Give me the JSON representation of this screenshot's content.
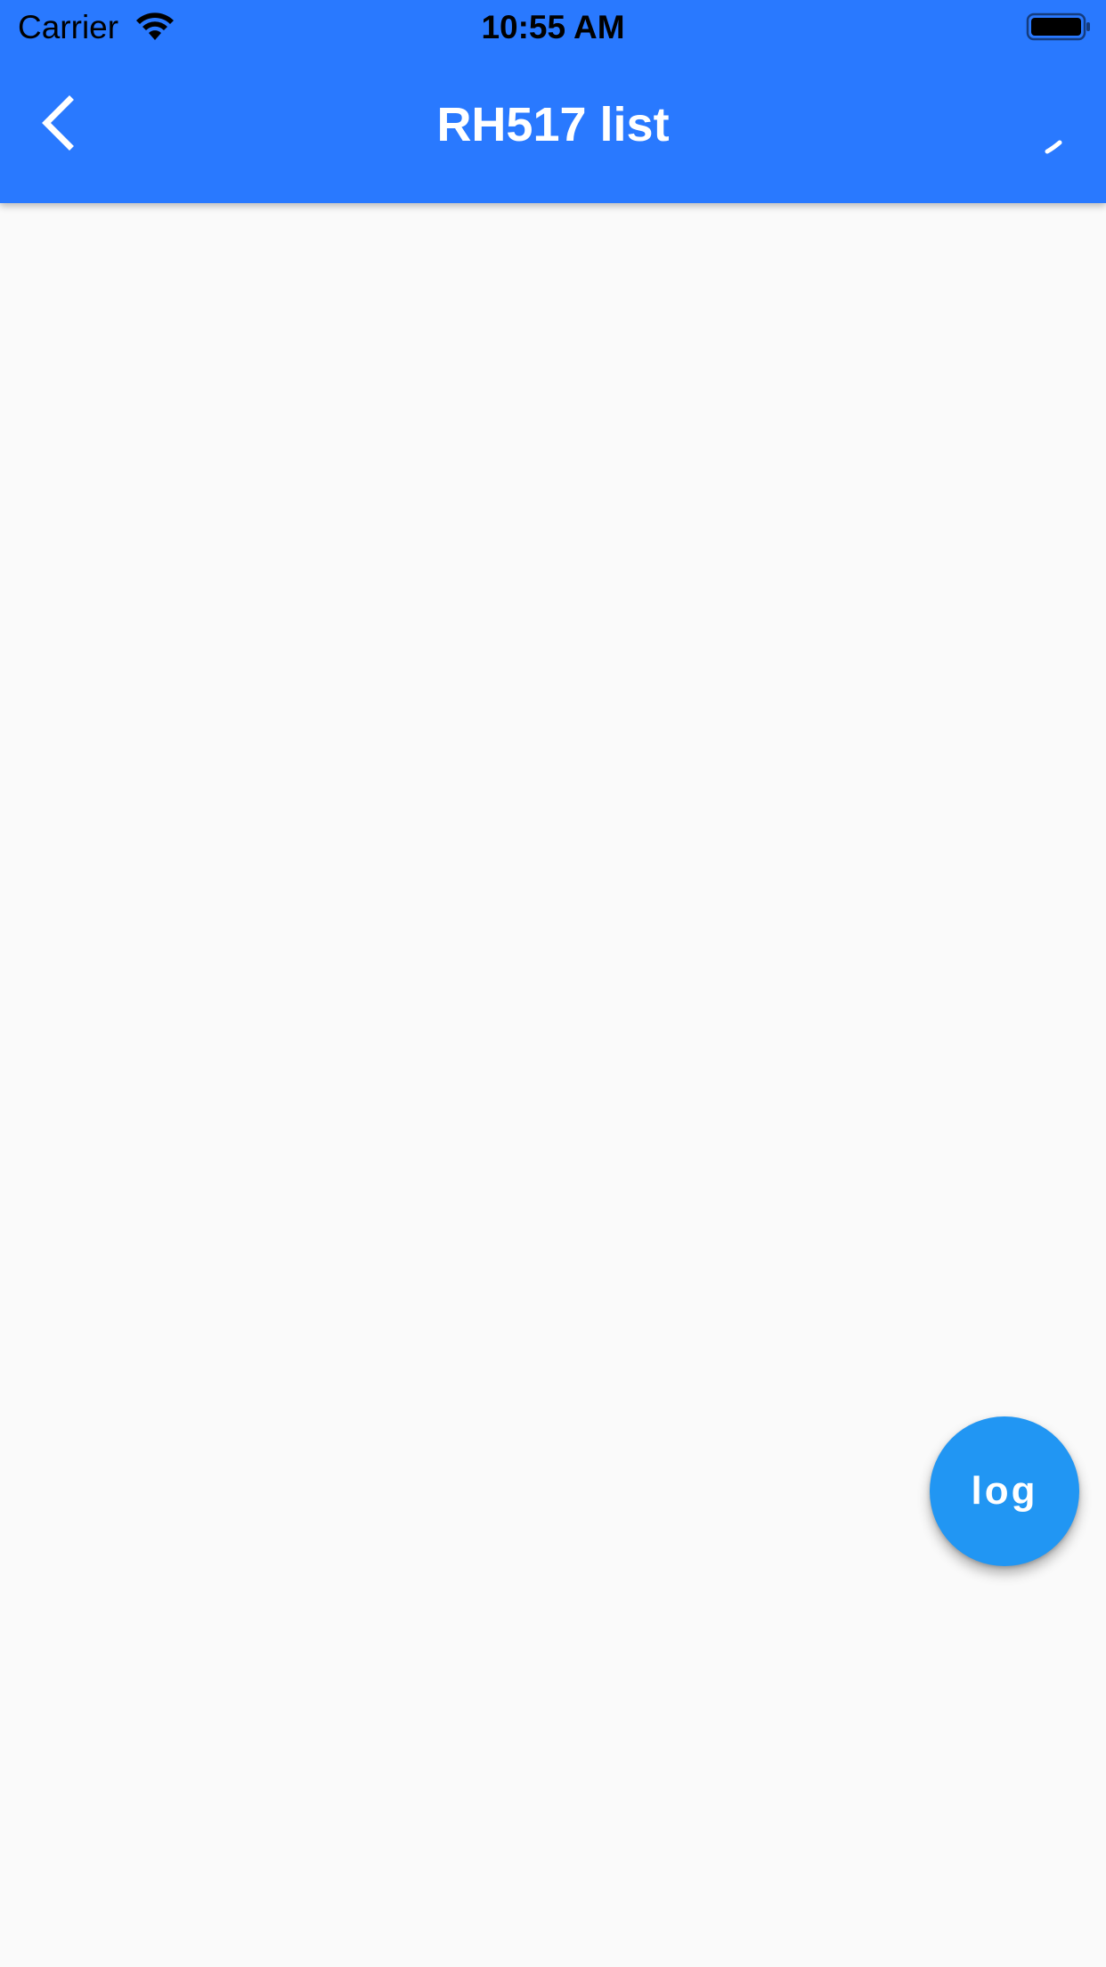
{
  "status_bar": {
    "carrier": "Carrier",
    "time": "10:55 AM",
    "wifi_icon": "wifi-icon",
    "battery_icon": "battery-icon"
  },
  "app_bar": {
    "title": "RH517 list",
    "background_color": "#2979ff",
    "back_icon": "chevron-left-icon",
    "action_icon": "loading-indicator-icon"
  },
  "fab": {
    "label": "log",
    "color": "#2196f3"
  },
  "body": {
    "background_color": "#fafafa"
  }
}
